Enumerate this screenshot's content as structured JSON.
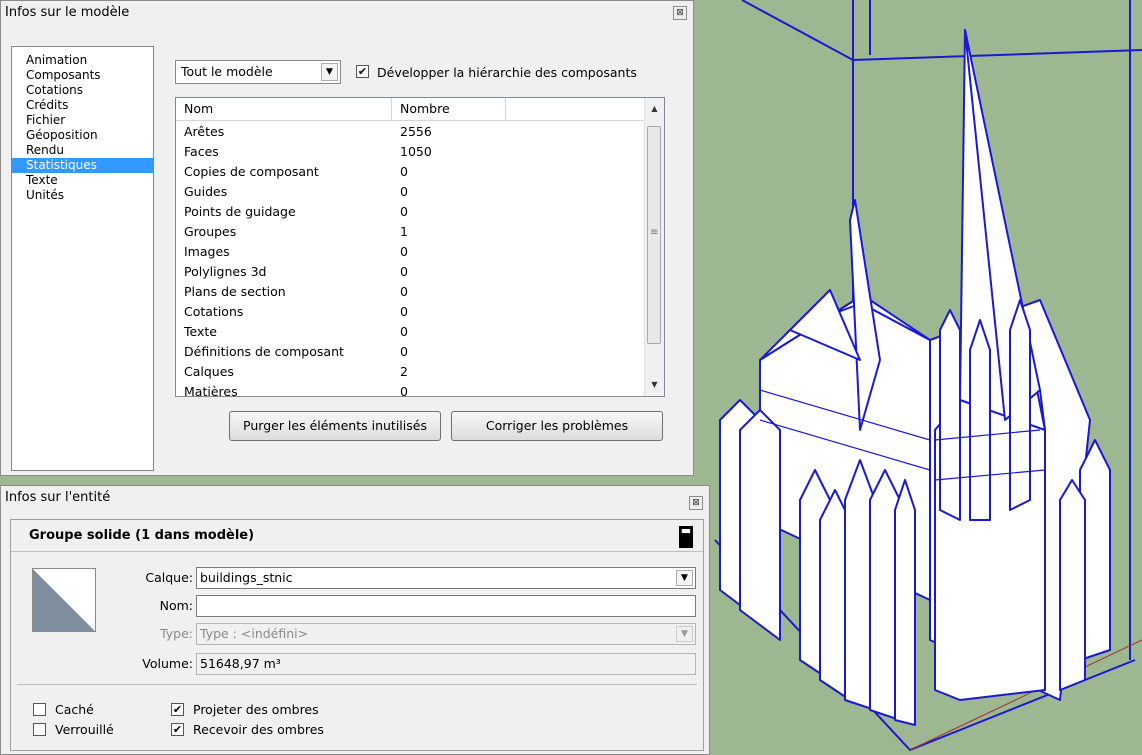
{
  "model_info": {
    "title": "Infos sur le modèle",
    "close_glyph": "⊠",
    "categories": [
      "Animation",
      "Composants",
      "Cotations",
      "Crédits",
      "Fichier",
      "Géoposition",
      "Rendu",
      "Statistiques",
      "Texte",
      "Unités"
    ],
    "selected_category_index": 7,
    "scope_value": "Tout le modèle",
    "dropdown_glyph": "▼",
    "expand_checkbox_label": "Développer la hiérarchie des composants",
    "expand_checked": true,
    "check_glyph": "✔",
    "table": {
      "headers": [
        "Nom",
        "Nombre"
      ],
      "rows": [
        [
          "Arêtes",
          "2556"
        ],
        [
          "Faces",
          "1050"
        ],
        [
          "Copies de composant",
          "0"
        ],
        [
          "Guides",
          "0"
        ],
        [
          "Points de guidage",
          "0"
        ],
        [
          "Groupes",
          "1"
        ],
        [
          "Images",
          "0"
        ],
        [
          "Polylignes 3d",
          "0"
        ],
        [
          "Plans de section",
          "0"
        ],
        [
          "Cotations",
          "0"
        ],
        [
          "Texte",
          "0"
        ],
        [
          "Définitions de composant",
          "0"
        ],
        [
          "Calques",
          "2"
        ],
        [
          "Matières",
          "0"
        ]
      ],
      "scroll_up_glyph": "▲",
      "scroll_down_glyph": "▼",
      "grip_glyph": "≡"
    },
    "purge_button": "Purger les éléments inutilisés",
    "fix_button": "Corriger les problèmes"
  },
  "entity_info": {
    "title": "Infos sur l'entité",
    "close_glyph": "⊠",
    "header": "Groupe solide (1 dans modèle)",
    "collapse_glyph": "▬",
    "layer_label": "Calque:",
    "layer_value": "buildings_stnic",
    "name_label": "Nom:",
    "name_value": "",
    "type_label": "Type:",
    "type_value": "Type : <indéfini>",
    "volume_label": "Volume:",
    "volume_value": "51648,97 m³",
    "hidden_label": "Caché",
    "locked_label": "Verrouillé",
    "cast_shadows_label": "Projeter des ombres",
    "receive_shadows_label": "Recevoir des ombres",
    "cast_checked": true,
    "receive_checked": true
  },
  "colors": {
    "viewport_bg": "#9db792",
    "model_edges": "#0000cc",
    "selection_blue": "#3399ff"
  }
}
